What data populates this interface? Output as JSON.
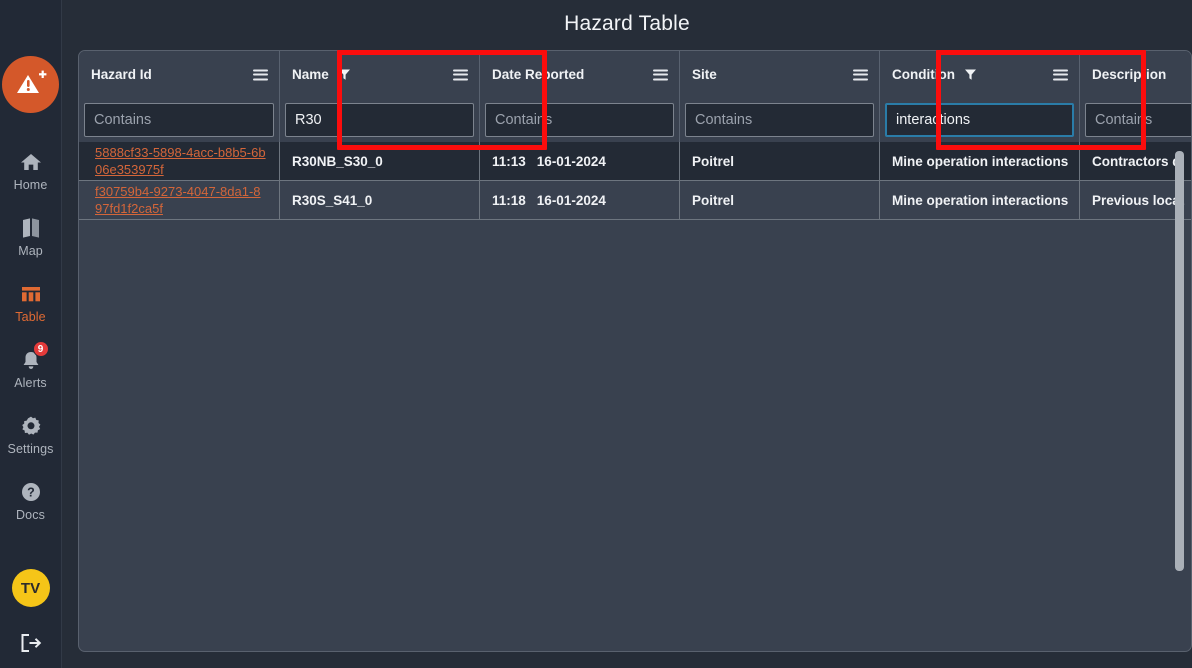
{
  "header": {
    "title": "Hazard Table",
    "back_icon": "arrow-left-icon"
  },
  "sidebar": {
    "logo": {
      "icon": "hazard-add-icon",
      "color": "#d4582a"
    },
    "items": [
      {
        "label": "Home",
        "icon": "home-icon",
        "active": false
      },
      {
        "label": "Map",
        "icon": "map-icon",
        "active": false
      },
      {
        "label": "Table",
        "icon": "table-icon",
        "active": true
      },
      {
        "label": "Alerts",
        "icon": "bell-icon",
        "active": false,
        "badge": "9"
      },
      {
        "label": "Settings",
        "icon": "gear-icon",
        "active": false
      },
      {
        "label": "Docs",
        "icon": "question-icon",
        "active": false
      }
    ],
    "avatar": {
      "initials": "TV",
      "color": "#f5c518"
    },
    "logout": {
      "icon": "logout-icon"
    },
    "active_color": "#e06a33",
    "badge_color": "#e43a3a"
  },
  "table": {
    "columns": [
      {
        "label": "Hazard Id",
        "filter_active": false,
        "menu_icon": "hamburger-icon"
      },
      {
        "label": "Name",
        "filter_active": true,
        "filter_icon": "funnel-icon",
        "menu_icon": "hamburger-icon",
        "highlighted": true
      },
      {
        "label": "Date Reported",
        "filter_active": false,
        "menu_icon": "hamburger-icon"
      },
      {
        "label": "Site",
        "filter_active": false,
        "menu_icon": "hamburger-icon"
      },
      {
        "label": "Condition",
        "filter_active": true,
        "filter_icon": "funnel-icon",
        "menu_icon": "hamburger-icon",
        "highlighted": true
      },
      {
        "label": "Description",
        "filter_active": false,
        "menu_icon": "hamburger-icon"
      }
    ],
    "filters": [
      {
        "value": "",
        "placeholder": "Contains",
        "focused": false
      },
      {
        "value": "R30",
        "placeholder": "Contains",
        "focused": false
      },
      {
        "value": "",
        "placeholder": "Contains",
        "focused": false
      },
      {
        "value": "",
        "placeholder": "Contains",
        "focused": false
      },
      {
        "value": "interactions",
        "placeholder": "Contains",
        "focused": true
      },
      {
        "value": "",
        "placeholder": "Contains",
        "focused": false
      }
    ],
    "rows": [
      {
        "hazard_id": "5888cf33-5898-4acc-b8b5-6b06e353975f",
        "name": "R30NB_S30_0",
        "time": "11:13",
        "date": "16-01-2024",
        "site": "Poitrel",
        "condition": "Mine operation interactions",
        "description": "Contractors d"
      },
      {
        "hazard_id": "f30759b4-9273-4047-8da1-897fd1f2ca5f",
        "name": "R30S_S41_0",
        "time": "11:18",
        "date": "16-01-2024",
        "site": "Poitrel",
        "condition": "Mine operation interactions",
        "description": "Previous locat"
      }
    ],
    "link_color": "#d4663a",
    "focus_color": "#2a7ca8",
    "highlight_color": "#fb0d0d"
  }
}
